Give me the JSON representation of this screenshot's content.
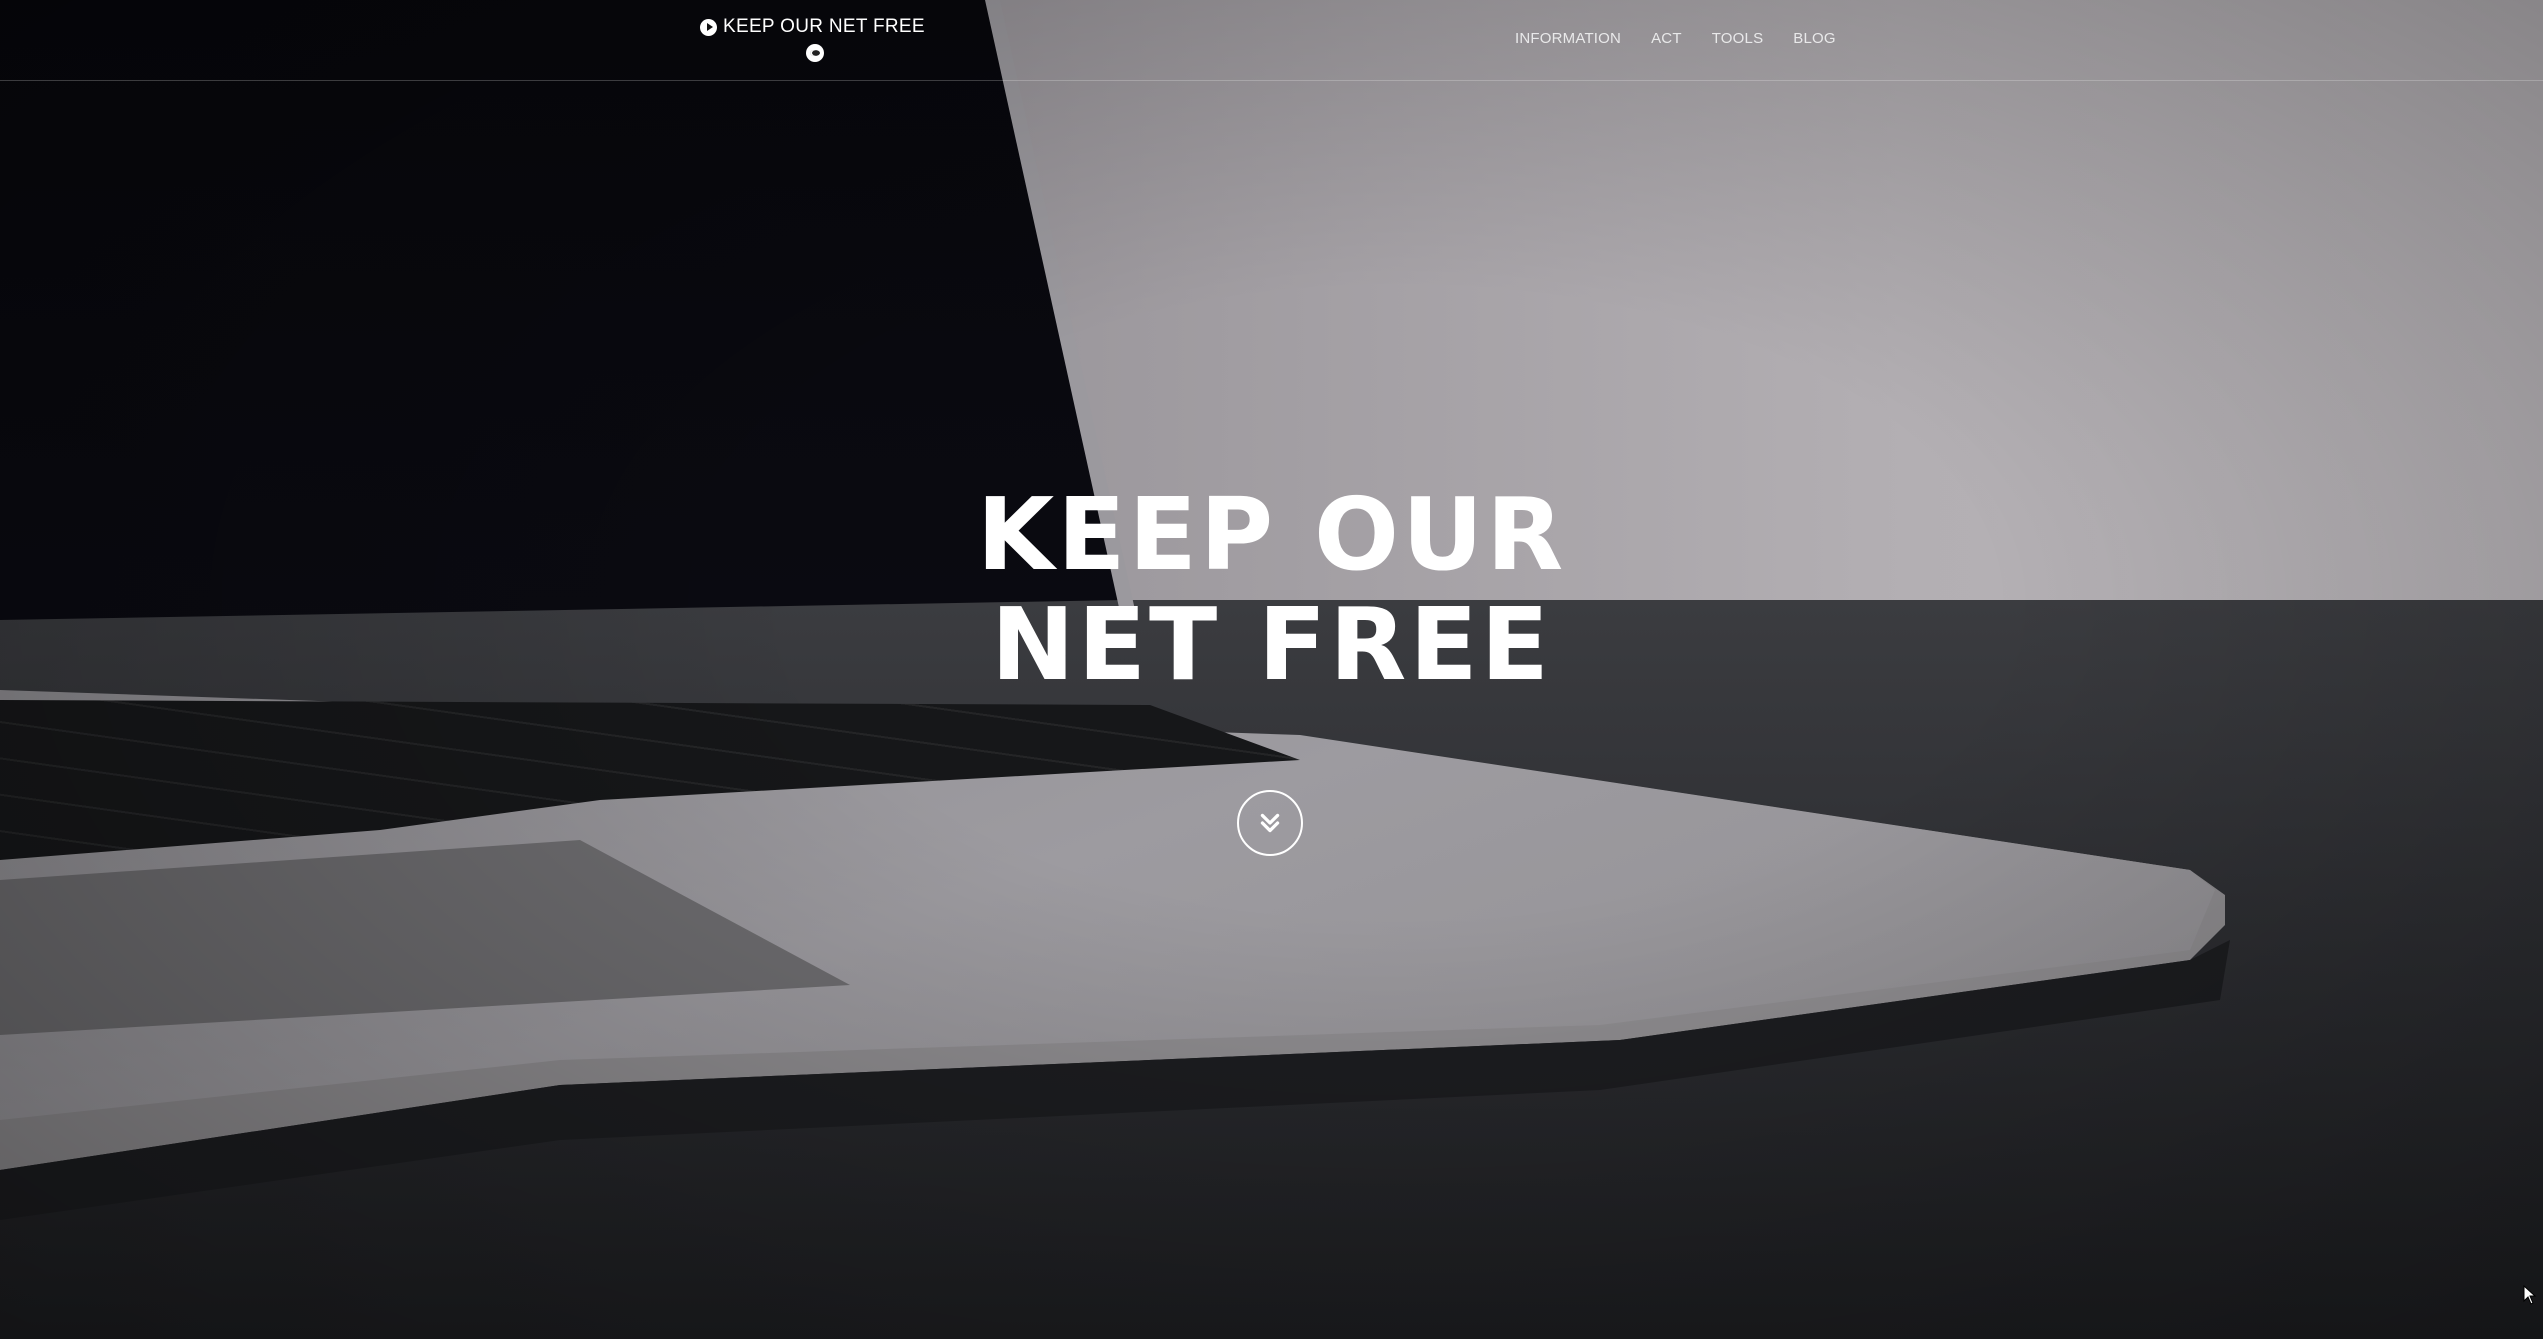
{
  "navbar": {
    "brand": "KEEP OUR NET FREE",
    "brand_icon": "play-circle-icon",
    "social_icon": "reddit-icon",
    "links": [
      {
        "label": "INFORMATION"
      },
      {
        "label": "ACT"
      },
      {
        "label": "TOOLS"
      },
      {
        "label": "BLOG"
      }
    ]
  },
  "hero": {
    "title_line1": "KEEP OUR",
    "title_line2": "NET FREE",
    "scroll_icon": "chevron-double-down-icon"
  },
  "colors": {
    "text": "#ffffff",
    "nav_text": "#e9e9ea",
    "divider": "rgba(255,255,255,0.22)"
  }
}
